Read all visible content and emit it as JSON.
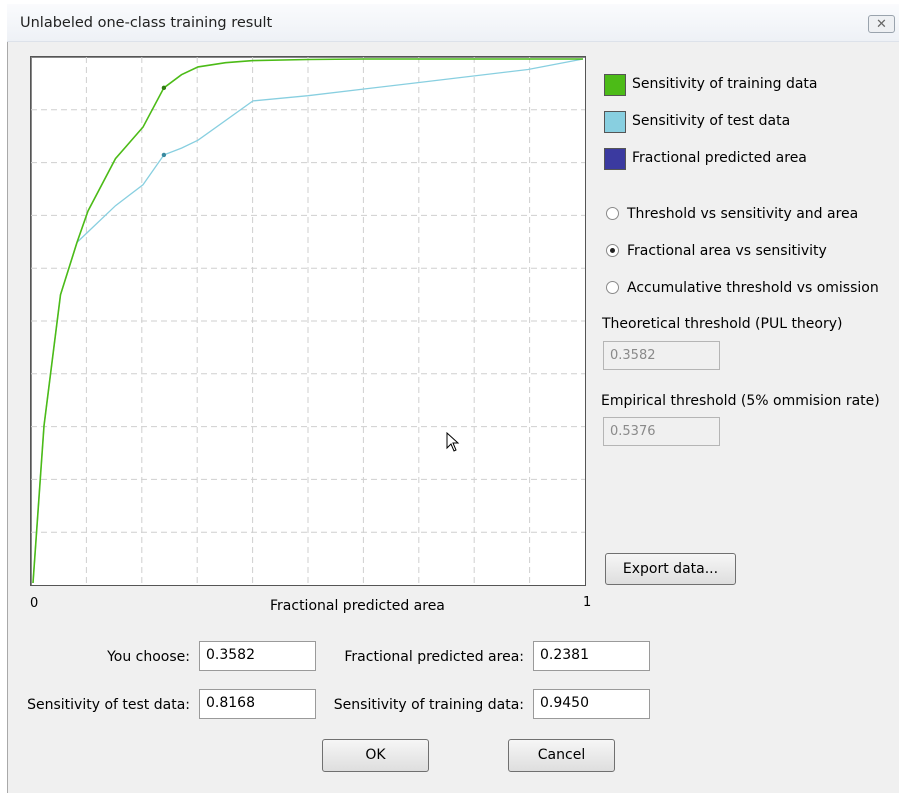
{
  "window": {
    "title": "Unlabeled one-class training result"
  },
  "icons": {
    "close": "close-icon",
    "cursor": "mouse-pointer-icon"
  },
  "chart_data": {
    "type": "line",
    "xlabel": "Fractional predicted area",
    "xtick_labels": [
      "0",
      "1"
    ],
    "xlim": [
      0,
      1
    ],
    "ylim": [
      0,
      1
    ],
    "grid": true,
    "legend_position": "right",
    "series": [
      {
        "name": "Sensitivity of training data",
        "color": "#4cbb17",
        "x": [
          0,
          0.02,
          0.05,
          0.08,
          0.1,
          0.15,
          0.2,
          0.238,
          0.27,
          0.3,
          0.35,
          0.4,
          0.5,
          0.6,
          0.8,
          1.0
        ],
        "y": [
          0,
          0.3,
          0.55,
          0.65,
          0.71,
          0.81,
          0.87,
          0.945,
          0.97,
          0.985,
          0.993,
          0.997,
          0.999,
          1.0,
          1.0,
          1.0
        ],
        "marker": {
          "x": 0.238,
          "y": 0.945
        }
      },
      {
        "name": "Sensitivity of test data",
        "color": "#88cfe0",
        "x": [
          0,
          0.02,
          0.05,
          0.08,
          0.1,
          0.15,
          0.2,
          0.238,
          0.27,
          0.3,
          0.4,
          0.5,
          0.7,
          0.9,
          1.0
        ],
        "y": [
          0,
          0.3,
          0.55,
          0.65,
          0.67,
          0.72,
          0.76,
          0.817,
          0.83,
          0.845,
          0.92,
          0.93,
          0.955,
          0.98,
          1.0
        ],
        "marker": {
          "x": 0.238,
          "y": 0.817
        }
      },
      {
        "name": "Fractional predicted area",
        "color": "#3b3aa0",
        "x": [],
        "y": []
      }
    ]
  },
  "options": {
    "radio": [
      {
        "label": "Threshold vs sensitivity and area",
        "checked": false
      },
      {
        "label": "Fractional area vs sensitivity",
        "checked": true
      },
      {
        "label": "Accumulative threshold vs omission",
        "checked": false
      }
    ],
    "theoretical_label": "Theoretical threshold (PUL theory)",
    "theoretical_value": "0.3582",
    "empirical_label": "Empirical threshold (5% ommision rate)",
    "empirical_value": "0.5376",
    "export_label": "Export data..."
  },
  "fields": {
    "you_choose_label": "You choose:",
    "you_choose_value": "0.3582",
    "frac_area_label": "Fractional predicted area:",
    "frac_area_value": "0.2381",
    "sens_test_label": "Sensitivity of test data:",
    "sens_test_value": "0.8168",
    "sens_train_label": "Sensitivity of training data:",
    "sens_train_value": "0.9450"
  },
  "buttons": {
    "ok": "OK",
    "cancel": "Cancel"
  }
}
